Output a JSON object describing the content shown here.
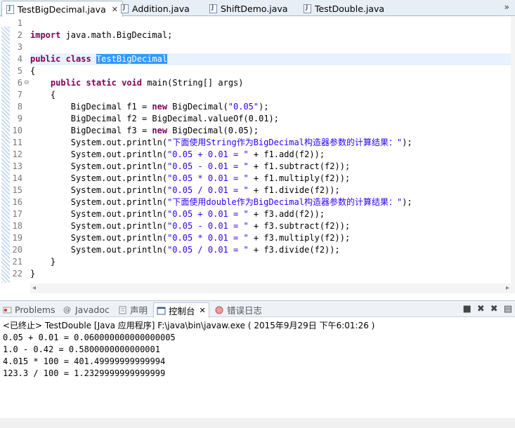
{
  "editor_tabs": [
    {
      "label": "TestBigDecimal.java",
      "active": true,
      "close": "✕"
    },
    {
      "label": "Addition.java",
      "active": false
    },
    {
      "label": "ShiftDemo.java",
      "active": false
    },
    {
      "label": "TestDouble.java",
      "active": false
    }
  ],
  "tab_overflow": "»",
  "line_numbers": [
    "1",
    "2",
    "3",
    "4",
    "5",
    "6",
    "7",
    "8",
    "9",
    "10",
    "11",
    "12",
    "13",
    "14",
    "15",
    "16",
    "17",
    "18",
    "19",
    "20",
    "21",
    "22"
  ],
  "code": {
    "l2_kw": "import",
    "l2_rest": " java.math.BigDecimal;",
    "l4_kw1": "public",
    "l4_kw2": "class",
    "l4_sel": "TestBigDecimal",
    "l5": "{",
    "l6_kw1": "public",
    "l6_kw2": "static",
    "l6_kw3": "void",
    "l6_rest": " main(String[] args)",
    "l7": "    {",
    "l8_a": "        BigDecimal f1 = ",
    "l8_kw": "new",
    "l8_b": " BigDecimal(",
    "l8_s": "\"0.05\"",
    "l8_c": ");",
    "l9": "        BigDecimal f2 = BigDecimal.valueOf(0.01);",
    "l10_a": "        BigDecimal f3 = ",
    "l10_kw": "new",
    "l10_b": " BigDecimal(0.05);",
    "l11_a": "        System.out.println(",
    "l11_s1": "\"",
    "l11_c1": "下面使用",
    "l11_s2": "String",
    "l11_c2": "作为",
    "l11_s3": "BigDecimal",
    "l11_c3": "构造器参数的计算结果：",
    "l11_s4": "\"",
    "l11_b": ");",
    "l12_a": "        System.out.println(",
    "l12_s": "\"0.05 + 0.01 = \"",
    "l12_b": " + f1.add(f2));",
    "l13_a": "        System.out.println(",
    "l13_s": "\"0.05 - 0.01 = \"",
    "l13_b": " + f1.subtract(f2));",
    "l14_a": "        System.out.println(",
    "l14_s": "\"0.05 * 0.01 = \"",
    "l14_b": " + f1.multiply(f2));",
    "l15_a": "        System.out.println(",
    "l15_s": "\"0.05 / 0.01 = \"",
    "l15_b": " + f1.divide(f2));",
    "l16_a": "        System.out.println(",
    "l16_s1": "\"",
    "l16_c1": "下面使用",
    "l16_s2": "double",
    "l16_c2": "作为",
    "l16_s3": "BigDecimal",
    "l16_c3": "构造器参数的计算结果：",
    "l16_s4": "\"",
    "l16_b": ");",
    "l17_a": "        System.out.println(",
    "l17_s": "\"0.05 + 0.01 = \"",
    "l17_b": " + f3.add(f2));",
    "l18_a": "        System.out.println(",
    "l18_s": "\"0.05 - 0.01 = \"",
    "l18_b": " + f3.subtract(f2));",
    "l19_a": "        System.out.println(",
    "l19_s": "\"0.05 * 0.01 = \"",
    "l19_b": " + f3.multiply(f2));",
    "l20_a": "        System.out.println(",
    "l20_s": "\"0.05 / 0.01 = \"",
    "l20_b": " + f3.divide(f2));",
    "l21": "    }",
    "l22": "}"
  },
  "panel_tabs": [
    {
      "label": "Problems",
      "icon": "problems-icon"
    },
    {
      "label": "Javadoc",
      "icon": "javadoc-icon"
    },
    {
      "label": "声明",
      "icon": "declaration-icon"
    },
    {
      "label": "控制台",
      "icon": "console-icon",
      "active": true,
      "close": "✕"
    },
    {
      "label": "错误日志",
      "icon": "error-log-icon"
    }
  ],
  "console": {
    "status": "<已终止> TestDouble [Java 应用程序] F:\\java\\bin\\javaw.exe ( 2015年9月29日 下午6:01:26 )",
    "output": [
      "0.05 + 0.01 = 0.060000000000000005",
      "1.0 - 0.42 = 0.5800000000000001",
      "4.015 * 100 = 401.49999999999994",
      "123.3 / 100 = 1.2329999999999999"
    ]
  },
  "colors": {
    "keyword": "#7f0055",
    "string": "#2a00ff",
    "selection": "#3399ff",
    "current_line": "#e8f2fe"
  }
}
